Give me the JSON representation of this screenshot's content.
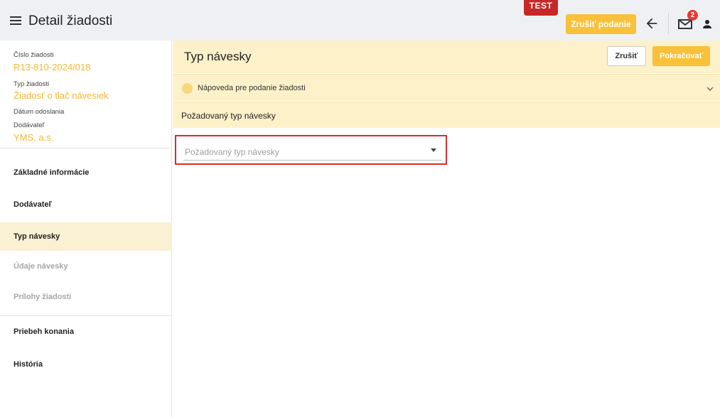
{
  "app": {
    "title": "Detail žiadosti",
    "env_badge": "TEST",
    "cancel_submission_label": "Zrušiť podanie",
    "notifications_count": "2"
  },
  "sidebar": {
    "request_number_label": "Číslo žiadosti",
    "request_number": "R13-810-2024/018",
    "request_type_label": "Typ žiadosti",
    "request_type": "Žiadosť o tlač návesiek",
    "sent_date_label": "Dátum odoslania",
    "supplier_label": "Dodávateľ",
    "supplier": "YMS, a.s.",
    "items": [
      {
        "label": "Základné informácie",
        "state": "normal"
      },
      {
        "label": "Dodávateľ",
        "state": "normal"
      },
      {
        "label": "Typ návesky",
        "state": "active"
      },
      {
        "label": "Údaje návesky",
        "state": "disabled"
      },
      {
        "label": "Prílohy žiadosti",
        "state": "disabled"
      },
      {
        "label": "Priebeh konania",
        "state": "normal"
      },
      {
        "label": "História",
        "state": "normal"
      }
    ]
  },
  "main": {
    "title": "Typ návesky",
    "cancel_label": "Zrušiť",
    "continue_label": "Pokračovať",
    "help_label": "Nápoveda pre podanie žiadosti",
    "section_title": "Požadovaný typ návesky",
    "select_placeholder": "Požadovaný typ návesky"
  },
  "colors": {
    "accent": "#f9c13a",
    "panel": "#fdf1c9",
    "highlight": "#d32f2f"
  }
}
